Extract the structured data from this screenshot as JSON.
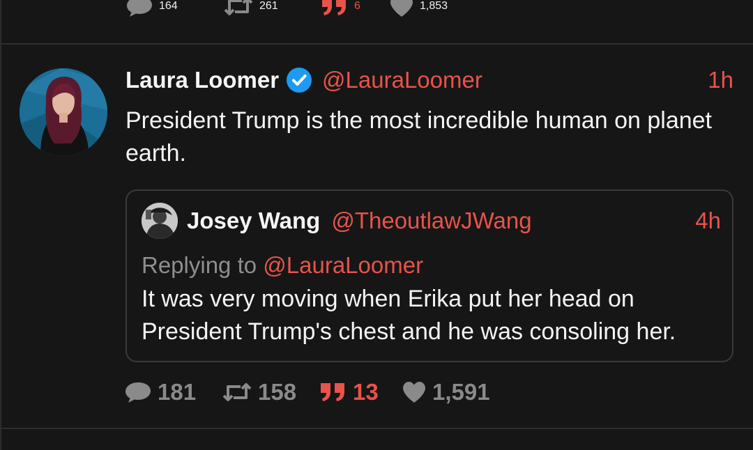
{
  "top_tweet_stats": {
    "replies": "164",
    "retweets": "261",
    "quotes": "6",
    "likes": "1,853"
  },
  "tweet": {
    "display_name": "Laura Loomer",
    "verified": true,
    "handle": "@LauraLoomer",
    "time": "1h",
    "text": "President Trump is the most incredible human on planet earth.",
    "quoted": {
      "display_name": "Josey Wang",
      "handle": "@TheoutlawJWang",
      "time": "4h",
      "replying_prefix": "Replying to",
      "replying_to": "@LauraLoomer",
      "text": "It was very moving when Erika put her head on President Trump's chest and he was consoling her."
    },
    "stats": {
      "replies": "181",
      "retweets": "158",
      "quotes": "13",
      "likes": "1,591"
    }
  },
  "colors": {
    "background": "#161616",
    "accent": "#e8534a",
    "muted": "#8a8a8a",
    "verified": "#1d9bf0"
  },
  "icons": [
    "reply-icon",
    "retweet-icon",
    "quote-icon",
    "like-icon",
    "verified-icon"
  ]
}
